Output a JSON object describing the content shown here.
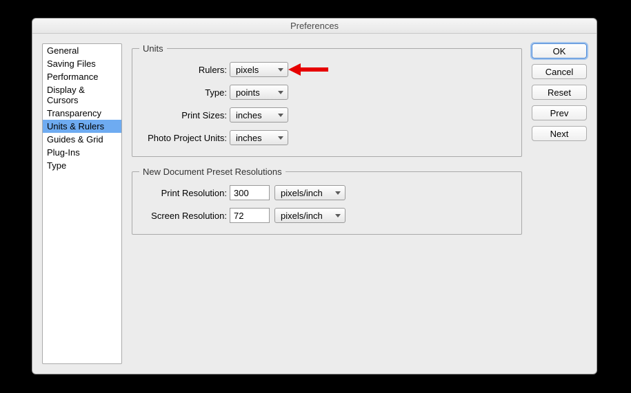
{
  "title": "Preferences",
  "sidebar": {
    "items": [
      {
        "label": "General"
      },
      {
        "label": "Saving Files"
      },
      {
        "label": "Performance"
      },
      {
        "label": "Display & Cursors"
      },
      {
        "label": "Transparency"
      },
      {
        "label": "Units & Rulers"
      },
      {
        "label": "Guides & Grid"
      },
      {
        "label": "Plug-Ins"
      },
      {
        "label": "Type"
      }
    ],
    "selectedIndex": 5
  },
  "units": {
    "legend": "Units",
    "rulers_label": "Rulers:",
    "rulers_value": "pixels",
    "type_label": "Type:",
    "type_value": "points",
    "print_sizes_label": "Print Sizes:",
    "print_sizes_value": "inches",
    "photo_project_label": "Photo Project Units:",
    "photo_project_value": "inches"
  },
  "resolutions": {
    "legend": "New Document Preset Resolutions",
    "print_res_label": "Print Resolution:",
    "print_res_value": "300",
    "print_res_unit": "pixels/inch",
    "screen_res_label": "Screen Resolution:",
    "screen_res_value": "72",
    "screen_res_unit": "pixels/inch"
  },
  "buttons": {
    "ok": "OK",
    "cancel": "Cancel",
    "reset": "Reset",
    "prev": "Prev",
    "next": "Next"
  }
}
